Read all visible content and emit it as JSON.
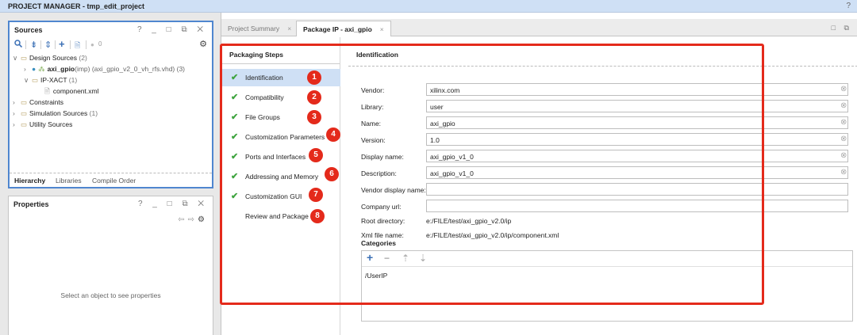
{
  "titlebar": {
    "title": "PROJECT MANAGER - tmp_edit_project",
    "help": "?"
  },
  "sources": {
    "title": "Sources",
    "window_controls": "? _ □ ⧉ ✕",
    "toolbar": {
      "search": "🔍",
      "collapse": "⇟",
      "expand": "⇕",
      "add": "+",
      "info": "🗎",
      "count": "0"
    },
    "tree": {
      "design_sources": "Design Sources",
      "design_sources_count": "(2)",
      "axi_gpio": "axi_gpio",
      "axi_gpio_detail": "(imp) (axi_gpio_v2_0_vh_rfs.vhd) (3)",
      "ip_xact": "IP-XACT",
      "ip_xact_count": "(1)",
      "component_xml": "component.xml",
      "constraints": "Constraints",
      "simulation_sources": "Simulation Sources",
      "simulation_sources_count": "(1)",
      "utility_sources": "Utility Sources"
    },
    "tabs": [
      "Hierarchy",
      "Libraries",
      "Compile Order"
    ]
  },
  "properties": {
    "title": "Properties",
    "window_controls": "? _ □ ⧉ ✕",
    "empty_message": "Select an object to see properties"
  },
  "main": {
    "tabs": [
      {
        "label": "Project Summary",
        "close": "×"
      },
      {
        "label": "Package IP - axi_gpio",
        "close": "×"
      }
    ],
    "window_controls": "□ ⧉"
  },
  "packaging": {
    "header": "Packaging Steps",
    "steps": [
      {
        "label": "Identification",
        "check": "✔",
        "badge": "1"
      },
      {
        "label": "Compatibility",
        "check": "✔",
        "badge": "2"
      },
      {
        "label": "File Groups",
        "check": "✔",
        "badge": "3"
      },
      {
        "label": "Customization Parameters",
        "check": "✔",
        "badge": "4"
      },
      {
        "label": "Ports and Interfaces",
        "check": "✔",
        "badge": "5"
      },
      {
        "label": "Addressing and Memory",
        "check": "✔",
        "badge": "6"
      },
      {
        "label": "Customization GUI",
        "check": "✔",
        "badge": "7"
      },
      {
        "label": "Review and Package",
        "check": "",
        "badge": "8"
      }
    ]
  },
  "identification": {
    "header": "Identification",
    "fields": [
      {
        "label": "Vendor:",
        "value": "xilinx.com"
      },
      {
        "label": "Library:",
        "value": "user"
      },
      {
        "label": "Name:",
        "value": "axi_gpio"
      },
      {
        "label": "Version:",
        "value": "1.0"
      },
      {
        "label": "Display name:",
        "value": "axi_gpio_v1_0"
      },
      {
        "label": "Description:",
        "value": "axi_gpio_v1_0"
      },
      {
        "label": "Vendor display name:",
        "value": ""
      },
      {
        "label": "Company url:",
        "value": ""
      }
    ],
    "clear_icon": "⊗",
    "root_directory_label": "Root directory:",
    "root_directory": "e:/FILE/test/axi_gpio_v2.0/ip",
    "xml_file_label": "Xml file name:",
    "xml_file": "e:/FILE/test/axi_gpio_v2.0/ip/component.xml",
    "categories_label": "Categories",
    "categories_toolbar": {
      "add": "+",
      "remove": "−",
      "up": "⇡",
      "down": "⇣"
    },
    "categories": [
      "/UserIP"
    ]
  }
}
